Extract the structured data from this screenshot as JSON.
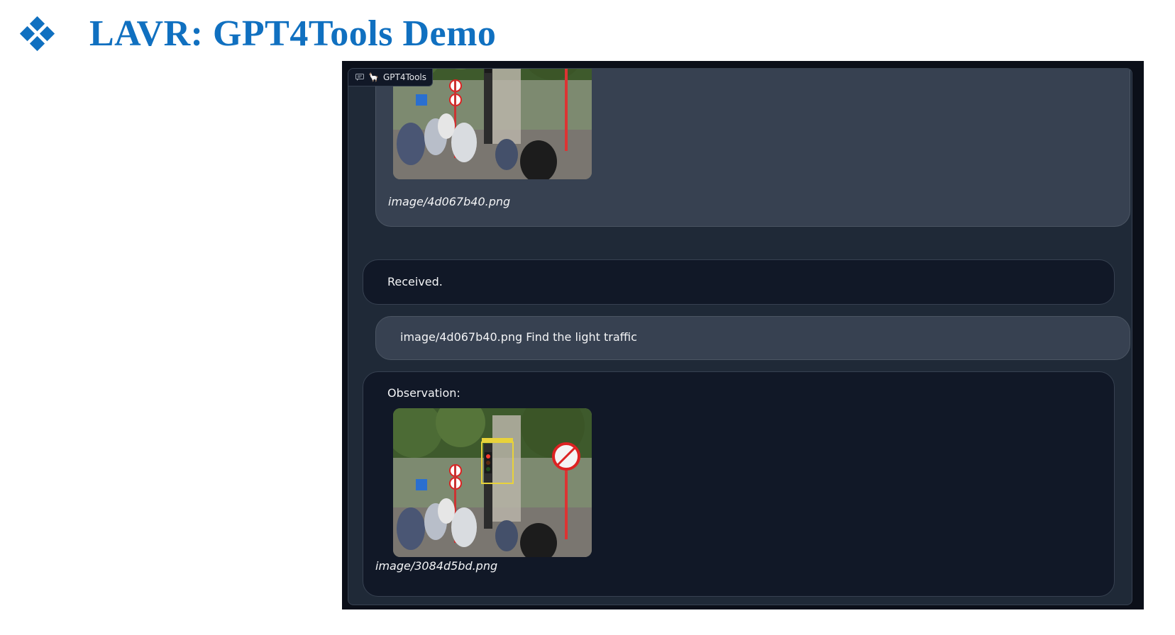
{
  "slide": {
    "title": "LAVR: GPT4Tools Demo",
    "bullet_icon": "diamond-bullet-icon",
    "accent_color": "#1070c0"
  },
  "app": {
    "chatbot_label": "GPT4Tools",
    "label_icons": [
      "chat-bubble-icon",
      "llama-icon"
    ],
    "theme": {
      "window_bg": "#0b0f19",
      "panel_bg": "#1f2937",
      "user_bubble": "#374151",
      "bot_bubble": "#111827"
    }
  },
  "messages": [
    {
      "role": "user",
      "image_caption": "image/4d067b40.png"
    },
    {
      "role": "bot",
      "text": "Received."
    },
    {
      "role": "user",
      "text": "image/4d067b40.png Find the light traffic"
    },
    {
      "role": "bot",
      "text": "Observation:",
      "image_caption": "image/3084d5bd.png"
    }
  ]
}
